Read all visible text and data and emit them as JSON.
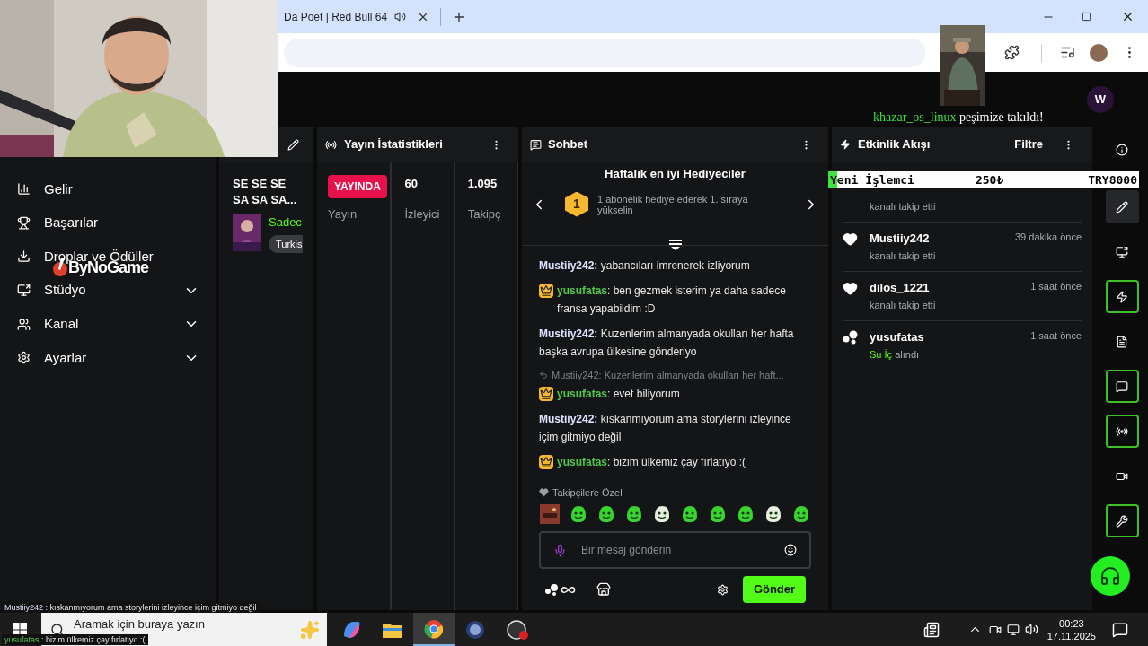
{
  "browser": {
    "tab_title": "Da Poet | Red Bull 64"
  },
  "top_bar": {
    "avatar": "W"
  },
  "sidebar": {
    "items": [
      {
        "label": "Gelir",
        "kind": "link"
      },
      {
        "label": "Başarılar",
        "kind": "link"
      },
      {
        "label": "Droplar ve Ödüller",
        "kind": "link"
      },
      {
        "label": "Stüdyo",
        "kind": "group"
      },
      {
        "label": "Kanal",
        "kind": "group"
      },
      {
        "label": "Ayarlar",
        "kind": "group"
      }
    ]
  },
  "stream_info": {
    "title": "SE SE SE SA SA SA...",
    "category": "Sadec",
    "tag": "Turkis"
  },
  "stats": {
    "title": "Yayın İstatistikleri",
    "items": [
      {
        "kind": "badge",
        "value": "YAYINDA",
        "label": "Yayın"
      },
      {
        "kind": "number",
        "value": "60",
        "label": "İzleyici"
      },
      {
        "kind": "number",
        "value": "1.095",
        "label": "Takipç"
      }
    ]
  },
  "chat": {
    "title": "Sohbet",
    "gifters_title": "Haftalık en iyi Hediyeciler",
    "rank": "1",
    "gifter_text": "1 abonelik hediye ederek 1. sıraya yükselin",
    "messages": [
      {
        "user": "Mustiiy242:",
        "text": "yabancıları imrenerek izliyorum",
        "subscriber": false
      },
      {
        "user": "yusufatas",
        "text": ": ben gezmek isterim ya daha sadece fransa yapabildim :D",
        "subscriber": true
      },
      {
        "user": "Mustiiy242:",
        "text": "Kuzenlerim almanyada okulları her hafta başka avrupa ülkesine gönderiyo",
        "subscriber": false
      },
      {
        "user": "yusufatas",
        "text": ": evet biliyorum",
        "subscriber": true,
        "reply_to": "Mustiiy242: Kuzenlerim almanyada okulları her haft..."
      },
      {
        "user": "Mustiiy242:",
        "text": "kıskanmıyorum ama storylerini izleyince içim gitmiyo değil",
        "subscriber": false
      },
      {
        "user": "yusufatas",
        "text": ": bizim ülkemiz çay fırlatıyo :(",
        "subscriber": true
      }
    ],
    "followers_only": "Takipçilere Özel",
    "placeholder": "Bir mesaj gönderin",
    "send": "Gönder"
  },
  "activity": {
    "title": "Etkinlik Akışı",
    "filter": "Filtre",
    "events": [
      {
        "kind": "follow",
        "detail": "kanalı takip etti"
      },
      {
        "kind": "follow",
        "user": "Mustiiy242",
        "time": "39 dakika önce",
        "detail": "kanalı takip etti"
      },
      {
        "kind": "follow",
        "user": "dilos_1221",
        "time": "1 saat önce",
        "detail": "kanalı takip etti"
      },
      {
        "kind": "reward",
        "user": "yusufatas",
        "time": "1 saat önce",
        "reward": "Su İç",
        "detail": "alındı"
      }
    ]
  },
  "rail": [
    {
      "kind": "info",
      "highlighted": false,
      "selected": false
    },
    {
      "kind": "pencil",
      "highlighted": false,
      "selected": true
    },
    {
      "kind": "studio",
      "highlighted": false,
      "selected": false
    },
    {
      "kind": "bolt",
      "highlighted": true,
      "selected": false
    },
    {
      "kind": "notes",
      "highlighted": false,
      "selected": false
    },
    {
      "kind": "chat",
      "highlighted": true,
      "selected": false
    },
    {
      "kind": "broadcast",
      "highlighted": true,
      "selected": false
    },
    {
      "kind": "camera",
      "highlighted": false,
      "selected": false
    },
    {
      "kind": "wrench",
      "highlighted": true,
      "selected": false
    }
  ],
  "overlays": {
    "alert": {
      "user": "khazar_os_linux",
      "text": "peşimize takıldı!"
    },
    "goal": {
      "title": "Yeni İşlemci",
      "amount": "250₺",
      "target": "TRY8000",
      "level": 0.03
    },
    "logo": "ByNoGame",
    "chat_lines": [
      {
        "user": "Mustiiy242",
        "text": ": kıskanmıyorum ama storylerini izleyince içim gitmiyo değil"
      },
      {
        "user": "yusufatas",
        "text": ": bizim ülkemiz çay fırlatıyo :("
      }
    ]
  },
  "taskbar": {
    "search_placeholder": "Aramak için buraya yazın",
    "time": "00:23",
    "date": "17.11.2025"
  }
}
